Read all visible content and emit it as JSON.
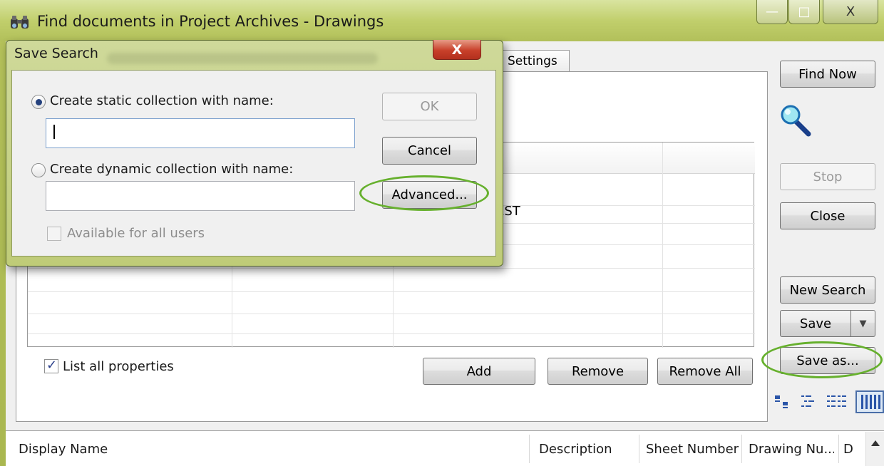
{
  "window": {
    "title": "Find documents in Project Archives - Drawings",
    "minimize": "—",
    "maximize": "□",
    "close": "X"
  },
  "tabs": {
    "settings": "Settings"
  },
  "grid": {
    "visible_cell": "EST"
  },
  "options": {
    "list_all_properties": "List all properties",
    "list_all_checked": true
  },
  "property_buttons": {
    "add": "Add",
    "remove": "Remove",
    "remove_all": "Remove All"
  },
  "side_buttons": {
    "find_now": "Find Now",
    "stop": "Stop",
    "close": "Close",
    "new_search": "New Search",
    "save": "Save",
    "save_dropdown": "▼",
    "save_as": "Save as..."
  },
  "results_columns": [
    "Display Name",
    "Description",
    "Sheet Number",
    "Drawing Nu...",
    "D"
  ],
  "dialog": {
    "title": "Save Search",
    "close": "X",
    "static_label": "Create static collection with name:",
    "static_selected": true,
    "static_value": "",
    "dynamic_label": "Create dynamic collection with name:",
    "dynamic_value": "",
    "available_label": "Available for all users",
    "ok": "OK",
    "cancel": "Cancel",
    "advanced": "Advanced..."
  },
  "colors": {
    "highlight": "#66b02d",
    "titlebar": "#c1cf6c",
    "dialog_close": "#c8402a"
  }
}
